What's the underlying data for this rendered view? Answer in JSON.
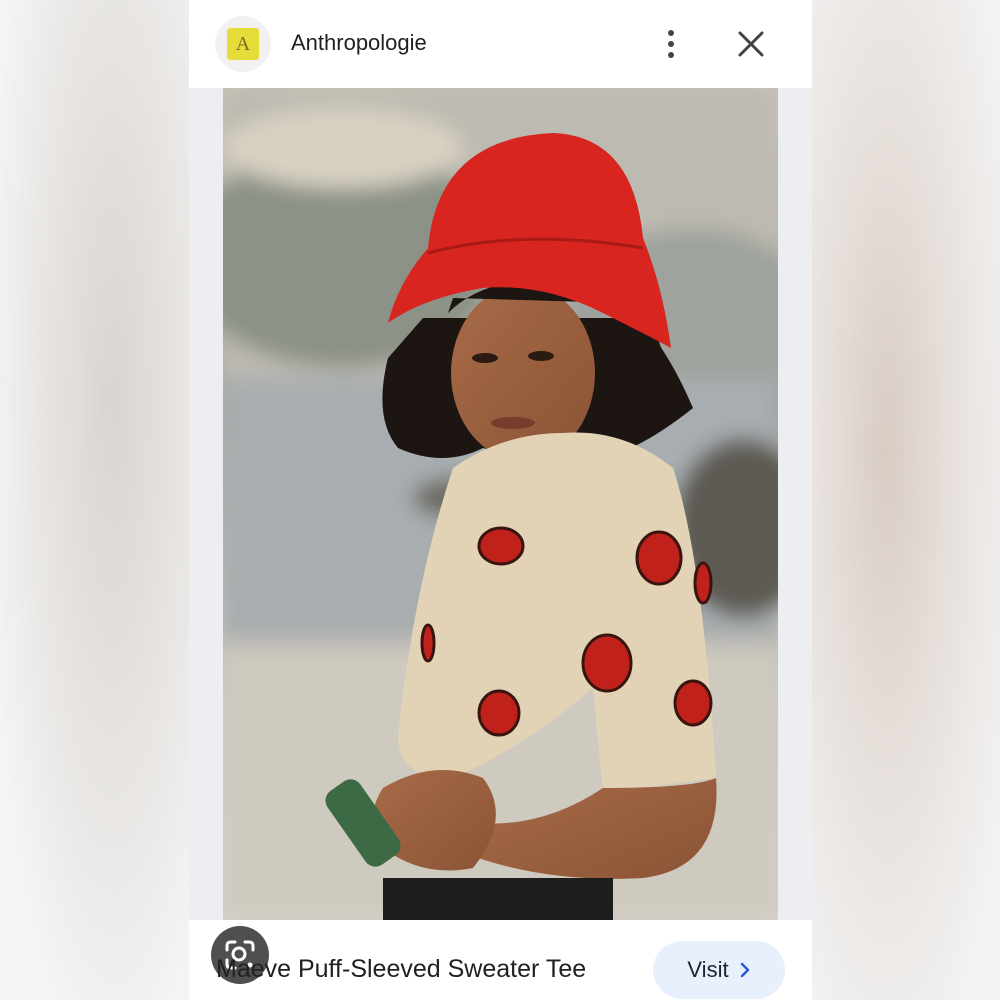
{
  "header": {
    "logo_letter": "A",
    "site_name": "Anthropologie"
  },
  "product": {
    "title": "Maeve Puff-Sleeved Sweater Tee"
  },
  "actions": {
    "visit_label": "Visit"
  },
  "icons": {
    "more": "more-vert-icon",
    "close": "close-icon",
    "lens": "google-lens-icon",
    "chevron": "chevron-right-icon"
  },
  "colors": {
    "logo_bg": "#e6dd3a",
    "visit_bg": "#e8effd",
    "hat": "#d8251f"
  }
}
